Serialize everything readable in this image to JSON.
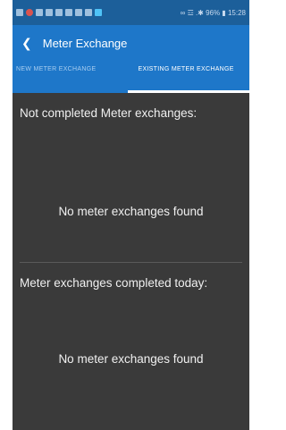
{
  "status": {
    "text": "∞ ☲ .✱ 96% ▮ 15:28"
  },
  "app": {
    "title": "Meter Exchange",
    "back_icon": "arrow-left-icon"
  },
  "tabs": [
    {
      "label": "NEW METER EXCHANGE",
      "active": false
    },
    {
      "label": "EXISTING METER EXCHANGE",
      "active": true
    }
  ],
  "sections": {
    "not_completed": {
      "title": "Not completed Meter exchanges:",
      "empty": "No meter exchanges found"
    },
    "completed_today": {
      "title": "Meter exchanges completed today:",
      "empty": "No meter exchanges found"
    }
  },
  "colors": {
    "appbar": "#1e77c9",
    "statusbar": "#1c5f9a",
    "background": "#3a3a3a"
  }
}
